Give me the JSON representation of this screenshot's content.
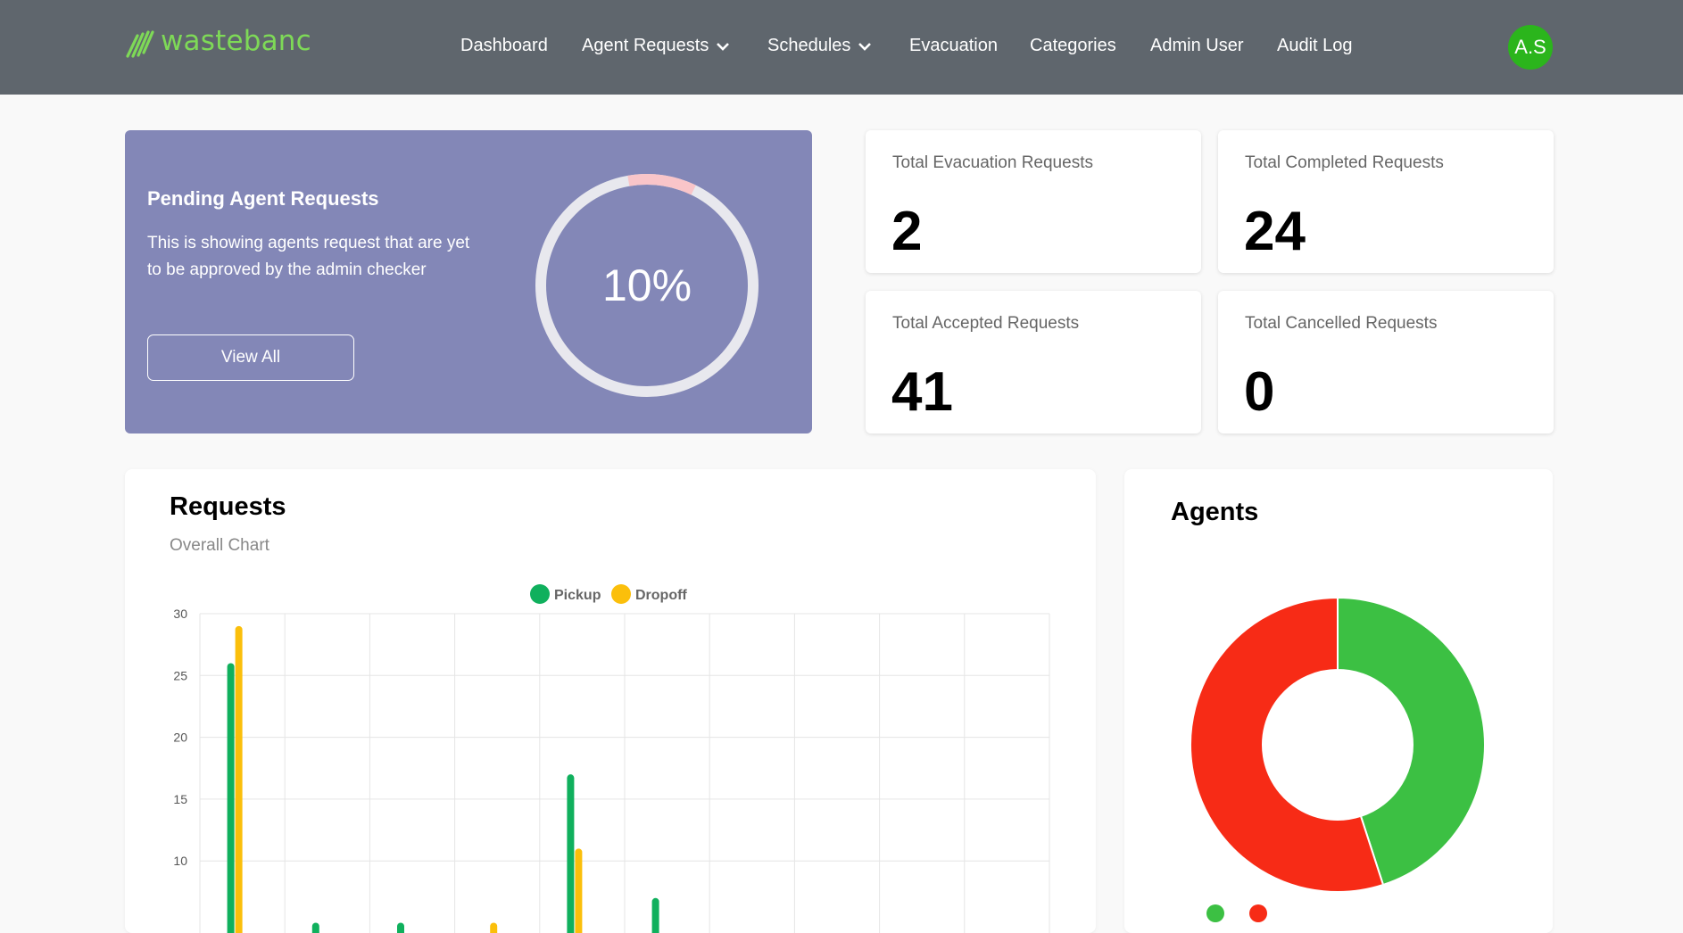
{
  "header": {
    "logo_text": "wastebanc",
    "nav": [
      {
        "label": "Dashboard",
        "dropdown": false
      },
      {
        "label": "Agent Requests",
        "dropdown": true
      },
      {
        "label": "Schedules",
        "dropdown": true
      },
      {
        "label": "Evacuation",
        "dropdown": false
      },
      {
        "label": "Categories",
        "dropdown": false
      },
      {
        "label": "Admin User",
        "dropdown": false
      },
      {
        "label": "Audit Log",
        "dropdown": false
      }
    ],
    "avatar_initials": "A.S"
  },
  "pending": {
    "title": "Pending Agent Requests",
    "description": "This is showing agents request that are yet to be approved by the admin checker",
    "button_label": "View All",
    "percent_label": "10%",
    "percent": 10
  },
  "stats": [
    {
      "label": "Total Evacuation Requests",
      "value": "2"
    },
    {
      "label": "Total Completed Requests",
      "value": "24"
    },
    {
      "label": "Total Accepted Requests",
      "value": "41"
    },
    {
      "label": "Total Cancelled Requests",
      "value": "0"
    }
  ],
  "requests_chart": {
    "title": "Requests",
    "subtitle": "Overall Chart"
  },
  "agents_chart": {
    "title": "Agents"
  },
  "colors": {
    "header_bg": "#5f666d",
    "logo_green": "#7ed957",
    "avatar_green": "#2bb51c",
    "pending_bg": "#8387b7",
    "pickup": "#10b05d",
    "dropoff": "#fbbf0b",
    "active": "#3cc043",
    "inactive": "#f72b16"
  },
  "chart_data": [
    {
      "type": "bar",
      "title": "",
      "categories": [
        "",
        "",
        "",
        "",
        "",
        "",
        "",
        "",
        "",
        ""
      ],
      "series": [
        {
          "name": "Pickup",
          "color": "#10b05d",
          "values": [
            26,
            5,
            5,
            0,
            17,
            7,
            0,
            0,
            0,
            0
          ]
        },
        {
          "name": "Dropoff",
          "color": "#fbbf0b",
          "values": [
            29,
            0,
            0,
            5,
            11,
            0,
            0,
            0,
            0,
            0
          ]
        }
      ],
      "y_ticks": [
        "30",
        "25",
        "20",
        "15",
        "10"
      ],
      "ylim": [
        0,
        30
      ],
      "legend": "top-center",
      "grid": true
    },
    {
      "type": "pie",
      "donut": true,
      "title": "",
      "slices": [
        {
          "name": "",
          "value": 45,
          "color": "#3cc043"
        },
        {
          "name": "",
          "value": 55,
          "color": "#f72b16"
        }
      ]
    }
  ]
}
